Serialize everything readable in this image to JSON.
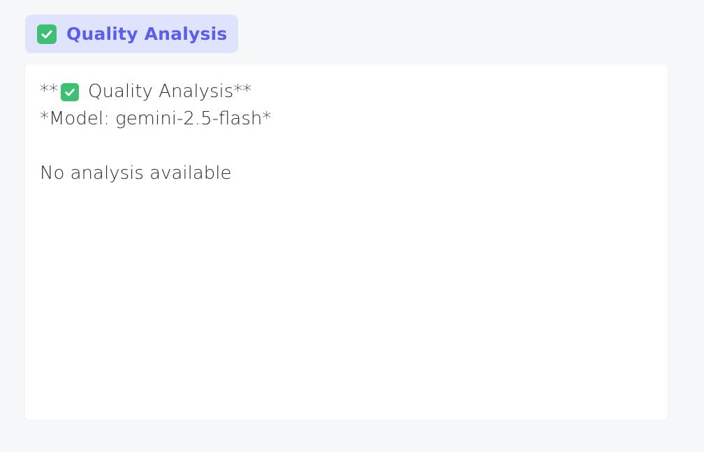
{
  "header": {
    "icon": "check-mark-icon",
    "title": "Quality Analysis"
  },
  "panel": {
    "prefix": "**",
    "icon": "check-mark-icon",
    "heading": "Quality Analysis**",
    "model_line": "*Model: gemini-2.5-flash*",
    "message": "No analysis available"
  },
  "colors": {
    "background": "#f6f7f9",
    "chip_bg": "#dfe3fb",
    "accent": "#5b5fe8",
    "check_green": "#3fbf74",
    "text": "#2a2d3a"
  }
}
